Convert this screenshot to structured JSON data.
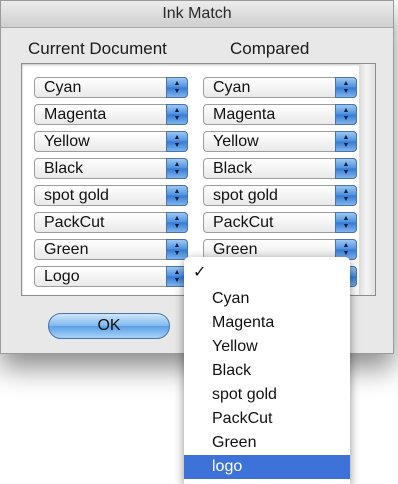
{
  "window": {
    "title": "Ink Match"
  },
  "headers": {
    "current": "Current Document",
    "compared": "Compared"
  },
  "rows": [
    {
      "current": "Cyan",
      "compared": "Cyan"
    },
    {
      "current": "Magenta",
      "compared": "Magenta"
    },
    {
      "current": "Yellow",
      "compared": "Yellow"
    },
    {
      "current": "Black",
      "compared": "Black"
    },
    {
      "current": "spot gold",
      "compared": "spot gold"
    },
    {
      "current": "PackCut",
      "compared": "PackCut"
    },
    {
      "current": "Green",
      "compared": "Green"
    },
    {
      "current": "Logo",
      "compared": ""
    }
  ],
  "buttons": {
    "ok": "OK",
    "cancel": ""
  },
  "menu": {
    "check_glyph": "✓",
    "items": [
      "",
      "Cyan",
      "Magenta",
      "Yellow",
      "Black",
      "spot gold",
      "PackCut",
      "Green",
      "logo"
    ],
    "selected_index": 8
  },
  "colors": {
    "accent": "#3d73d9",
    "stepper": "#4b8fe0"
  }
}
